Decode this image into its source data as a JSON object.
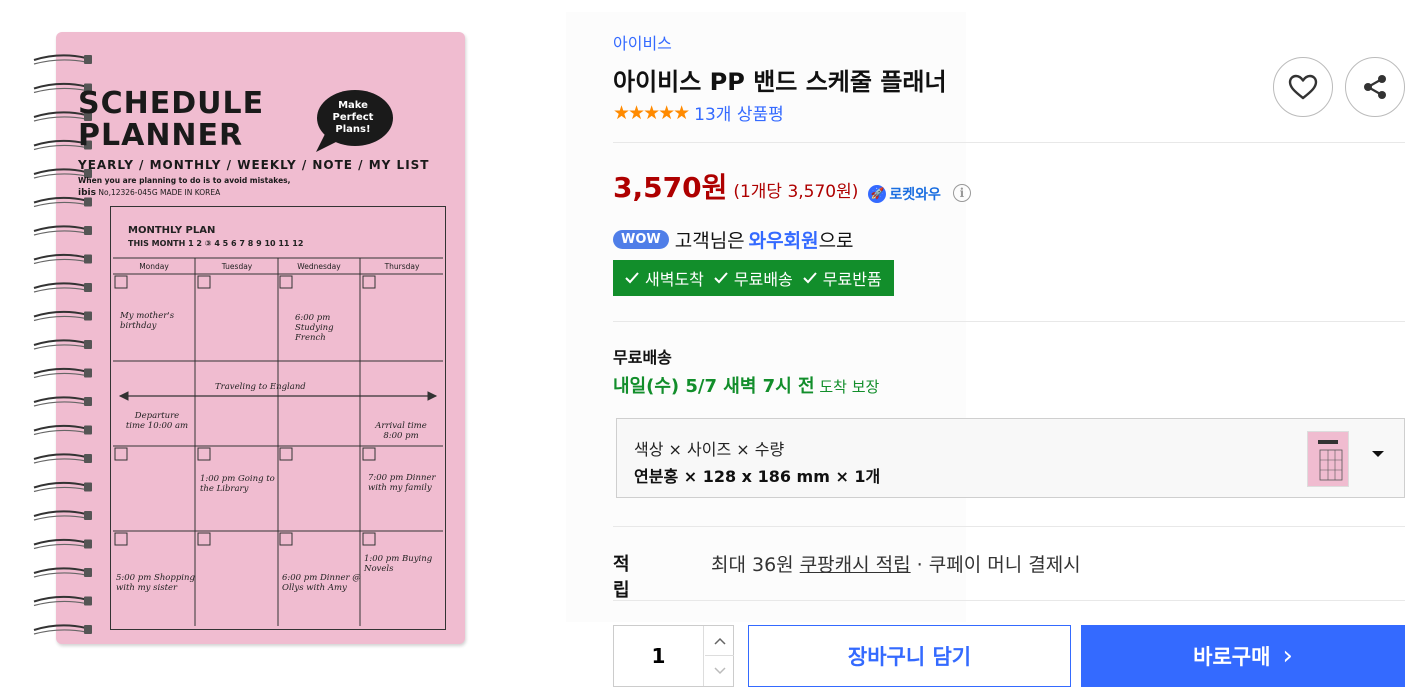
{
  "product_image": {
    "cover_title_line1": "SCHEDULE",
    "cover_title_line2": "PLANNER",
    "bubble_text": "Make Perfect Plans!",
    "cover_subtitle": "YEARLY / MONTHLY / WEEKLY / NOTE / MY LIST",
    "cover_small": "When you are planning to do is to avoid mistakes,",
    "cover_brand_name": "ibis",
    "cover_brand_rest": " No,12326-045G MADE IN KOREA",
    "plan_title": "MONTHLY PLAN",
    "plan_month": "THIS MONTH  1 2 ③ 4 5 6 7 8 9 10 11 12",
    "days": [
      "Monday",
      "Tuesday",
      "Wednesday",
      "Thursday"
    ],
    "notes": {
      "n1": "My mother's birthday",
      "n2": "6:00 pm Studying French",
      "n3": "Traveling to England",
      "n4": "Departure time 10:00 am",
      "n5": "Arrival time 8:00 pm",
      "n6": "1:00 pm Going to the Library",
      "n7": "7:00 pm Dinner with my family",
      "n8": "5:00 pm Shopping with my sister",
      "n9": "6:00 pm Dinner @ Ollys with Amy",
      "n10": "1:00 pm Buying Novels"
    }
  },
  "product": {
    "brand": "아이비스",
    "title": "아이비스 PP 밴드 스케줄 플래너",
    "stars": "★★★★★",
    "review_count": "13개 상품평",
    "price": "3,570원",
    "unit_price": "(1개당 3,570원)",
    "rocket_label": "로켓와우",
    "info_icon": "i"
  },
  "wow": {
    "badge": "WOW",
    "text_pre": "고객님은",
    "text_strong": "와우회원",
    "text_post": "으로",
    "benefits": [
      "새벽도착",
      "무료배송",
      "무료반품"
    ]
  },
  "shipping": {
    "label": "무료배송",
    "date_strong": "내일(수) 5/7 새벽 7시 전",
    "date_rest": " 도착 보장"
  },
  "option": {
    "label": "색상 × 사이즈 × 수량",
    "value": "연분홍 × 128 x 186 mm × 1개"
  },
  "points": {
    "label": "적립",
    "text_pre": "최대 36원 ",
    "link": "쿠팡캐시 적립",
    "text_post": " · 쿠페이 머니 결제시"
  },
  "purchase": {
    "quantity": "1",
    "cart_label": "장바구니 담기",
    "buy_label": "바로구매",
    "buy_chevron": "›"
  },
  "colors": {
    "accent": "#346aff",
    "price": "#ae0000",
    "green": "#128e2b",
    "cover_pink": "#f0bcd0",
    "star": "#ff8a00"
  }
}
